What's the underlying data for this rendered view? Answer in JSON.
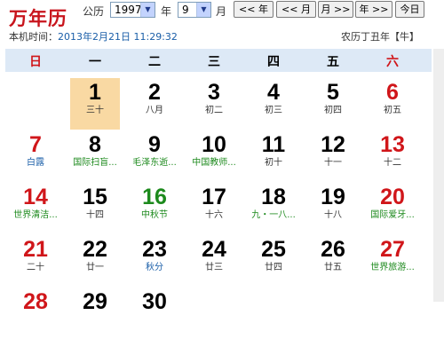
{
  "header": {
    "logo": "万年历",
    "gongli_label": "公历",
    "year_value": "1997",
    "year_label": "年",
    "month_value": "9",
    "month_label": "月",
    "buttons": {
      "prev_year": "<< 年",
      "prev_month": "<< 月",
      "next_month": "月 >>",
      "next_year": "年 >>",
      "today": "今日"
    },
    "local_time_label": "本机时间：",
    "local_time_value": "2013年2月21日 11:29:32",
    "lunar_year": "农历丁丑年【牛】"
  },
  "weekdays": [
    "日",
    "一",
    "二",
    "三",
    "四",
    "五",
    "六"
  ],
  "days": [
    {
      "num": "1",
      "sub": "三十",
      "today": true
    },
    {
      "num": "2",
      "sub": "八月"
    },
    {
      "num": "3",
      "sub": "初二"
    },
    {
      "num": "4",
      "sub": "初三"
    },
    {
      "num": "5",
      "sub": "初四"
    },
    {
      "num": "6",
      "sub": "初五"
    },
    {
      "num": "7",
      "sub": "白露",
      "subStyle": "blue"
    },
    {
      "num": "8",
      "sub": "国际扫盲...",
      "subStyle": "green"
    },
    {
      "num": "9",
      "sub": "毛泽东逝...",
      "subStyle": "green"
    },
    {
      "num": "10",
      "sub": "中国教师...",
      "subStyle": "green"
    },
    {
      "num": "11",
      "sub": "初十"
    },
    {
      "num": "12",
      "sub": "十一"
    },
    {
      "num": "13",
      "sub": "十二"
    },
    {
      "num": "14",
      "sub": "世界清洁...",
      "subStyle": "green"
    },
    {
      "num": "15",
      "sub": "十四"
    },
    {
      "num": "16",
      "sub": "中秋节",
      "subStyle": "green",
      "numStyle": "green"
    },
    {
      "num": "17",
      "sub": "十六"
    },
    {
      "num": "18",
      "sub": "九・一八...",
      "subStyle": "green"
    },
    {
      "num": "19",
      "sub": "十八"
    },
    {
      "num": "20",
      "sub": "国际爱牙...",
      "subStyle": "green"
    },
    {
      "num": "21",
      "sub": "二十"
    },
    {
      "num": "22",
      "sub": "廿一"
    },
    {
      "num": "23",
      "sub": "秋分",
      "subStyle": "blue"
    },
    {
      "num": "24",
      "sub": "廿三"
    },
    {
      "num": "25",
      "sub": "廿四"
    },
    {
      "num": "26",
      "sub": "廿五"
    },
    {
      "num": "27",
      "sub": "世界旅游...",
      "subStyle": "green"
    },
    {
      "num": "28",
      "sub": ""
    },
    {
      "num": "29",
      "sub": ""
    },
    {
      "num": "30",
      "sub": ""
    }
  ],
  "first_weekday_index": 1
}
